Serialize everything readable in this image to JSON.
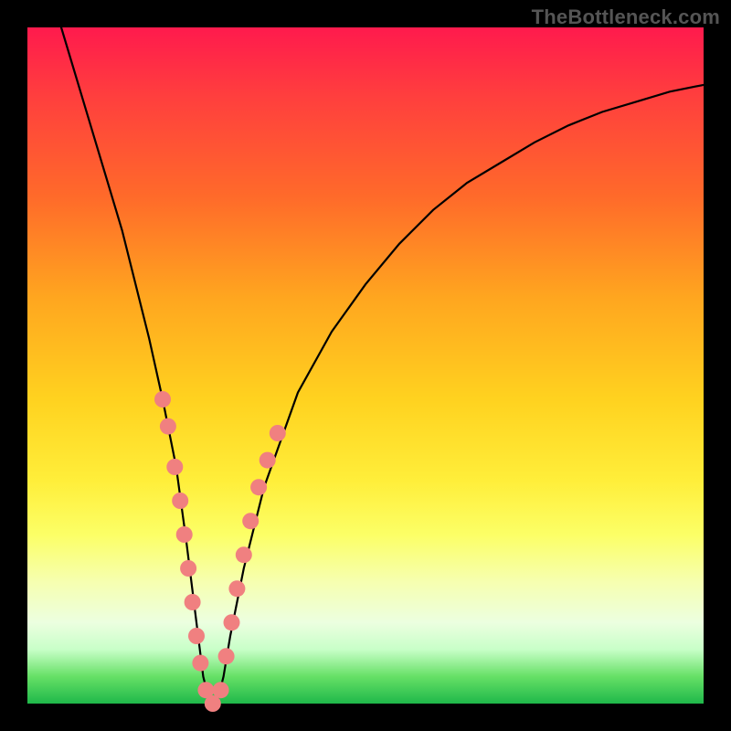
{
  "watermark": "TheBottleneck.com",
  "chart_data": {
    "type": "line",
    "title": "",
    "xlabel": "",
    "ylabel": "",
    "xlim": [
      0,
      100
    ],
    "ylim": [
      0,
      100
    ],
    "grid": false,
    "background_gradient": {
      "orientation": "vertical",
      "stops": [
        {
          "pos": 0,
          "color": "#ff1a4d"
        },
        {
          "pos": 25,
          "color": "#ff6a2a"
        },
        {
          "pos": 55,
          "color": "#ffd21f"
        },
        {
          "pos": 75,
          "color": "#fcff66"
        },
        {
          "pos": 92,
          "color": "#c8ffc8"
        },
        {
          "pos": 100,
          "color": "#1fb84a"
        }
      ]
    },
    "series": [
      {
        "name": "bottleneck-curve",
        "color": "#000000",
        "x": [
          5,
          8,
          11,
          14,
          16,
          18,
          20,
          22,
          23.5,
          25,
          26,
          27,
          28,
          29,
          30,
          32,
          35,
          40,
          45,
          50,
          55,
          60,
          65,
          70,
          75,
          80,
          85,
          90,
          95,
          100
        ],
        "y": [
          100,
          90,
          80,
          70,
          62,
          54,
          45,
          35,
          24,
          12,
          4,
          0,
          0,
          4,
          10,
          20,
          32,
          46,
          55,
          62,
          68,
          73,
          77,
          80,
          83,
          85.5,
          87.5,
          89,
          90.5,
          91.5
        ]
      }
    ],
    "markers": {
      "name": "highlight-dots",
      "color": "#f08080",
      "radius": 9,
      "points": [
        {
          "x": 20.0,
          "y": 45
        },
        {
          "x": 20.8,
          "y": 41
        },
        {
          "x": 21.8,
          "y": 35
        },
        {
          "x": 22.6,
          "y": 30
        },
        {
          "x": 23.2,
          "y": 25
        },
        {
          "x": 23.8,
          "y": 20
        },
        {
          "x": 24.4,
          "y": 15
        },
        {
          "x": 25.0,
          "y": 10
        },
        {
          "x": 25.6,
          "y": 6
        },
        {
          "x": 26.4,
          "y": 2
        },
        {
          "x": 27.4,
          "y": 0
        },
        {
          "x": 28.6,
          "y": 2
        },
        {
          "x": 29.4,
          "y": 7
        },
        {
          "x": 30.2,
          "y": 12
        },
        {
          "x": 31.0,
          "y": 17
        },
        {
          "x": 32.0,
          "y": 22
        },
        {
          "x": 33.0,
          "y": 27
        },
        {
          "x": 34.2,
          "y": 32
        },
        {
          "x": 35.5,
          "y": 36
        },
        {
          "x": 37.0,
          "y": 40
        }
      ]
    }
  }
}
